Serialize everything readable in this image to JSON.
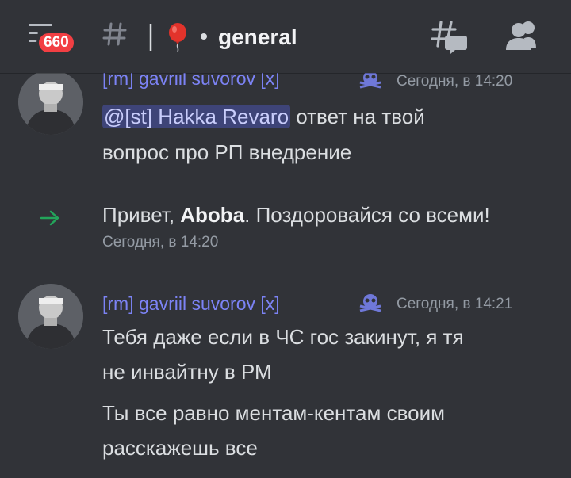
{
  "header": {
    "notification_count": "660",
    "channel_emoji": "balloon-icon",
    "channel_name": "general"
  },
  "colors": {
    "background": "#313338",
    "username": "#7c83f5",
    "mention_bg": "#3c4270",
    "badge": "#f23f43",
    "join_arrow": "#23a55a"
  },
  "messages": [
    {
      "username": "[rm] gavriil suvorov [x]",
      "timestamp": "Сегодня, в 14:20",
      "mention": "@[st] Hakka Revaro",
      "line1_rest": " ответ на твой",
      "line2": "вопрос про РП внедрение"
    },
    {
      "system_prefix": "Привет, ",
      "system_name": "Aboba",
      "system_suffix": ". Поздоровайся со всеми!",
      "timestamp": "Сегодня, в 14:20"
    },
    {
      "username": "[rm] gavriil suvorov [x]",
      "timestamp": "Сегодня, в 14:21",
      "line1": "Тебя даже если в ЧС гос закинут, я тя",
      "line2": "не инвайтну в РМ",
      "line3": "Ты все равно ментам-кентам своим",
      "line4": "расскажешь все"
    }
  ]
}
